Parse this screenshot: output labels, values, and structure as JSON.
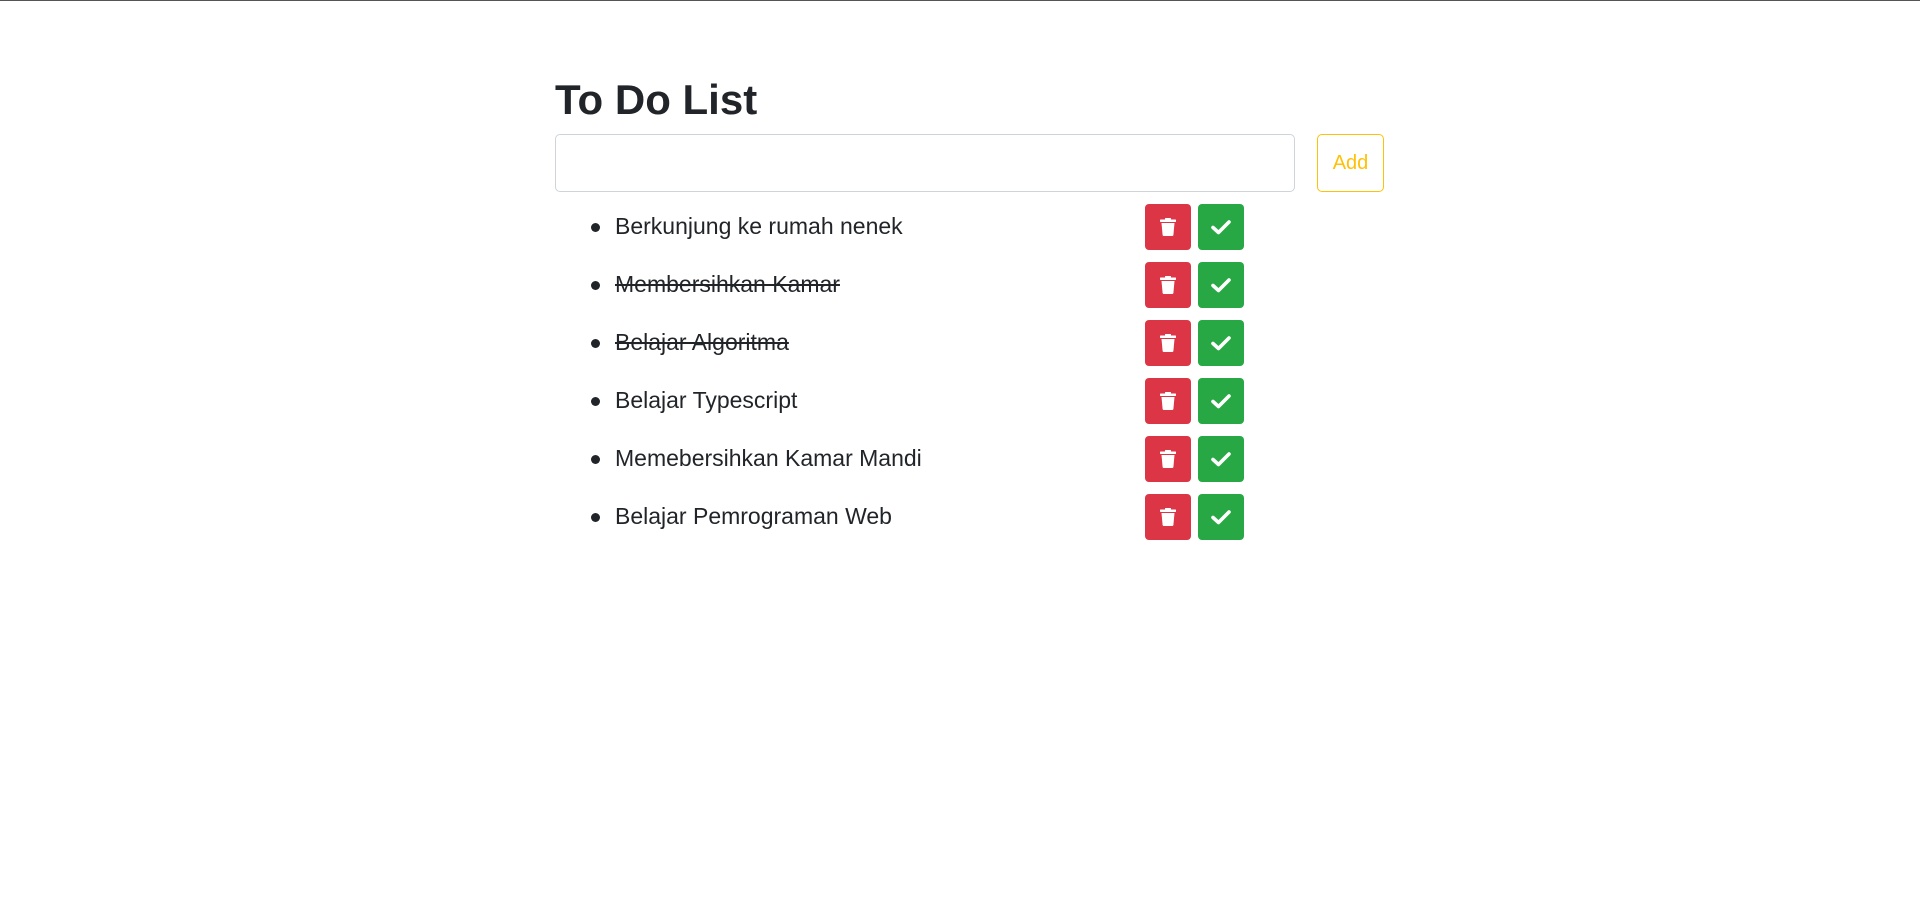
{
  "page": {
    "title": "To Do List"
  },
  "form": {
    "input_value": "",
    "input_placeholder": "",
    "add_label": "Add"
  },
  "colors": {
    "delete": "#dc3545",
    "done": "#28a745",
    "add_outline": "#ffc107"
  },
  "icons": {
    "delete": "trash-icon",
    "done": "check-icon"
  },
  "todos": [
    {
      "text": "Berkunjung ke rumah nenek",
      "completed": false
    },
    {
      "text": "Membersihkan Kamar",
      "completed": true
    },
    {
      "text": "Belajar Algoritma",
      "completed": true
    },
    {
      "text": "Belajar Typescript",
      "completed": false
    },
    {
      "text": "Memebersihkan Kamar Mandi",
      "completed": false
    },
    {
      "text": "Belajar Pemrograman Web",
      "completed": false
    }
  ]
}
